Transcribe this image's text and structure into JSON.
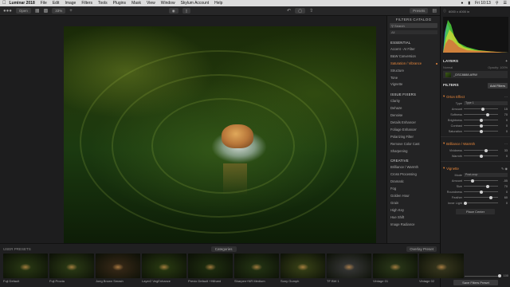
{
  "menubar": {
    "app_name": "Luminar 2018",
    "items": [
      "File",
      "Edit",
      "Image",
      "Filters",
      "Tools",
      "Plugins",
      "Mask",
      "View",
      "Window",
      "Skylum Account",
      "Help"
    ],
    "clock": "Fri 10:13"
  },
  "toolbar": {
    "view_select": "Open",
    "zoom_select": "33%",
    "presets_btn": "Presets"
  },
  "catalog": {
    "title": "FILTERS CATALOG",
    "search_placeholder": "Search",
    "all_label": "All",
    "sections": [
      {
        "title": "ESSENTIAL",
        "items": [
          "Accent - AI Filter",
          "B&W Conversion",
          "Saturation / Vibrance",
          "Structure",
          "Tone",
          "Vignette"
        ],
        "active_index": 2
      },
      {
        "title": "ISSUE FIXERS",
        "items": [
          "Clarity",
          "Dehaze",
          "Denoise",
          "Details Enhancer",
          "Foliage Enhancer",
          "Polarizing Filter",
          "Remove Color Cast",
          "Sharpening"
        ]
      },
      {
        "title": "CREATIVE",
        "items": [
          "Brilliance / Warmth",
          "Cross Processing",
          "Dramatic",
          "Fog",
          "Golden Hour",
          "Grain",
          "High Key",
          "Hue Shift",
          "Image Radiance"
        ]
      }
    ]
  },
  "right_panel": {
    "image_info": "6000 x 4000 in",
    "layers_title": "LAYERS",
    "layer_blend_label": "Normal",
    "layer_opacity_label": "Opacity: 100%",
    "layer_name": "_DSC8888.ARW",
    "filters_title": "FILTERS",
    "add_filters_btn": "Add Filters",
    "orton": {
      "title": "Orton Effect",
      "type_label": "Type",
      "type_value": "Type 1",
      "rows": [
        {
          "name": "Amount",
          "value": "15",
          "pos": 0.55
        },
        {
          "name": "Softness",
          "value": "70",
          "pos": 0.7
        },
        {
          "name": "Brightness",
          "value": "0",
          "pos": 0.5
        },
        {
          "name": "Contrast",
          "value": "0",
          "pos": 0.5
        },
        {
          "name": "Saturation",
          "value": "0",
          "pos": 0.5
        }
      ]
    },
    "brilliance": {
      "title": "Brilliance / Warmth",
      "rows": [
        {
          "name": "Vividness",
          "value": "33",
          "pos": 0.66
        },
        {
          "name": "Warmth",
          "value": "0",
          "pos": 0.5
        }
      ]
    },
    "vignette": {
      "title": "Vignette",
      "mode_label": "Mode",
      "mode_value": "Post-crop",
      "rows": [
        {
          "name": "Amount",
          "value": "-55",
          "pos": 0.25
        },
        {
          "name": "Size",
          "value": "70",
          "pos": 0.7
        },
        {
          "name": "Roundness",
          "value": "0",
          "pos": 0.5
        },
        {
          "name": "Feather",
          "value": "60",
          "pos": 0.8
        },
        {
          "name": "Inner Light",
          "value": "0",
          "pos": 0.05
        }
      ],
      "place_center_btn": "Place Center"
    },
    "filters_amount_label": "Filters Amount",
    "filters_amount_value": "100",
    "save_preset_btn": "Save Filters Preset"
  },
  "presets": {
    "header_label": "USER PRESETS",
    "categories_btn": "Categories",
    "overlay_btn": "Overlay Preset",
    "items": [
      {
        "label": "Fuji Default",
        "tone": "#2a3a14"
      },
      {
        "label": "Fuji Provia",
        "tone": "#2d3d16"
      },
      {
        "label": "Joeg Brown Smash",
        "tone": "#3a2a18"
      },
      {
        "label": "Layer2 VegEnhance",
        "tone": "#2a3c12"
      },
      {
        "label": "Previo Default +Hilhard",
        "tone": "#203010"
      },
      {
        "label": "Sharpen+NR Medium",
        "tone": "#253614"
      },
      {
        "label": "Sony Gumph",
        "tone": "#3a4418"
      },
      {
        "label": "TF BW 1",
        "tone": "#3a3a3a"
      },
      {
        "label": "Vintage 01",
        "tone": "#2c3a1a"
      },
      {
        "label": "Vintage 02",
        "tone": "#3b3a20"
      }
    ]
  }
}
